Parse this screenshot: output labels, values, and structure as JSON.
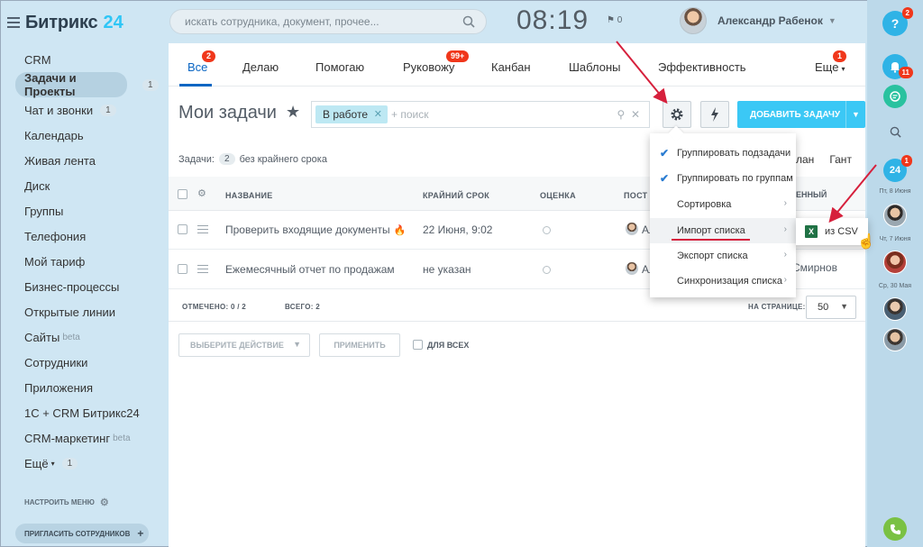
{
  "app": {
    "logo_text": "Битрикс",
    "logo_num": "24"
  },
  "sidebar": {
    "items": [
      {
        "label": "CRM"
      },
      {
        "label": "Задачи и Проекты",
        "count": "1"
      },
      {
        "label": "Чат и звонки",
        "count": "1"
      },
      {
        "label": "Календарь"
      },
      {
        "label": "Живая лента"
      },
      {
        "label": "Диск"
      },
      {
        "label": "Группы"
      },
      {
        "label": "Телефония"
      },
      {
        "label": "Мой тариф"
      },
      {
        "label": "Бизнес-процессы"
      },
      {
        "label": "Открытые линии"
      },
      {
        "label": "Сайты",
        "sup": "beta"
      },
      {
        "label": "Сотрудники"
      },
      {
        "label": "Приложения"
      },
      {
        "label": "1С + CRM Битрикс24"
      },
      {
        "label": "CRM-маркетинг",
        "sup": "beta"
      },
      {
        "label": "Ещё",
        "count": "1"
      }
    ],
    "setup_menu": "НАСТРОИТЬ МЕНЮ",
    "invite": "ПРИГЛАСИТЬ СОТРУДНИКОВ"
  },
  "header": {
    "search_placeholder": "искать сотрудника, документ, прочее...",
    "clock": "08:19",
    "flag_count": "0",
    "user_name": "Александр Рабенок"
  },
  "right_panel": {
    "help_badge": "2",
    "bell_badge": "11",
    "calendar_day": "24",
    "calendar_badge": "1",
    "dates": [
      "Пт, 8 Июня",
      "Чт, 7 Июня",
      "Ср, 30 Мая"
    ]
  },
  "tabs": [
    {
      "label": "Все",
      "badge": "2"
    },
    {
      "label": "Делаю"
    },
    {
      "label": "Помогаю"
    },
    {
      "label": "Руковожу",
      "badge": "99+"
    },
    {
      "label": "Канбан"
    },
    {
      "label": "Шаблоны"
    },
    {
      "label": "Эффективность"
    },
    {
      "label": "Еще",
      "badge": "1"
    }
  ],
  "toolbar": {
    "title": "Мои задачи",
    "filter_tag": "В работе",
    "filter_placeholder": "+ поиск",
    "add_task": "ДОБАВИТЬ ЗАДАЧУ"
  },
  "counters": {
    "label": "Задачи:",
    "count": "2",
    "text": "без крайнего срока"
  },
  "view_links": {
    "plan": "лан",
    "gantt": "Гант"
  },
  "grid": {
    "columns": {
      "name": "НАЗВАНИЕ",
      "deadline": "КРАЙНИЙ СРОК",
      "rating": "ОЦЕНКА",
      "creator": "ПОСТ",
      "responsible": "ЕННЫЙ"
    },
    "rows": [
      {
        "title": "Проверить входящие документы",
        "deadline": "22 Июня, 9:02",
        "creator": "Ал"
      },
      {
        "title": "Ежемесячный отчет по продажам",
        "deadline": "не указан",
        "creator": "Ал",
        "responsible": "Смирнов"
      }
    ],
    "footer": {
      "marked": "ОТМЕЧЕНО: 0 / 2",
      "total": "ВСЕГО: 2",
      "per_page_label": "НА СТРАНИЦЕ:",
      "per_page": "50"
    }
  },
  "bulk": {
    "action_placeholder": "ВЫБЕРИТЕ ДЕЙСТВИЕ",
    "apply": "ПРИМЕНИТЬ",
    "for_all": "ДЛЯ ВСЕХ"
  },
  "popup": {
    "items": [
      {
        "label": "Группировать подзадачи",
        "checked": true
      },
      {
        "label": "Группировать по группам",
        "checked": true
      },
      {
        "label": "Сортировка"
      },
      {
        "label": "Импорт списка"
      },
      {
        "label": "Экспорт списка"
      },
      {
        "label": "Синхронизация списка"
      }
    ],
    "submenu_item": "из CSV"
  },
  "colors": {
    "accent": "#3bc8f5",
    "tab_active": "#0b66c3",
    "badge": "#f0371b",
    "annotation": "#d6203c"
  }
}
